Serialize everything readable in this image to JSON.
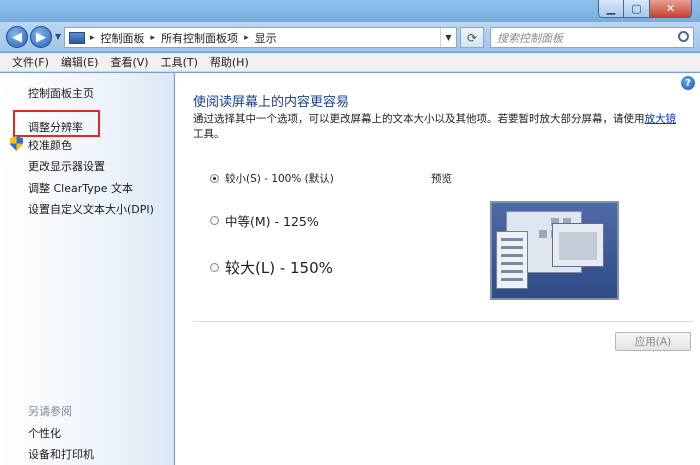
{
  "window": {
    "close_glyph": "✕",
    "maximize_glyph": "▢",
    "minimize_glyph": "▁"
  },
  "address": {
    "crumbs": [
      "控制面板",
      "所有控制面板项",
      "显示"
    ],
    "separator": "▸"
  },
  "search": {
    "placeholder": "搜索控制面板"
  },
  "menu": [
    "文件(F)",
    "编辑(E)",
    "查看(V)",
    "工具(T)",
    "帮助(H)"
  ],
  "sidebar": {
    "home": "控制面板主页",
    "links": [
      "调整分辨率",
      "校准颜色",
      "更改显示器设置",
      "调整 ClearType 文本",
      "设置自定义文本大小(DPI)"
    ],
    "see_also_title": "另请参阅",
    "see_also": [
      "个性化",
      "设备和打印机"
    ]
  },
  "main": {
    "title": "使阅读屏幕上的内容更容易",
    "description": "通过选择其中一个选项，可以更改屏幕上的文本大小以及其他项。若要暂时放大部分屏幕，请使用",
    "description_link": "放大镜",
    "description_tail": "工具。",
    "options": [
      {
        "label": "较小(S) - 100% (默认)",
        "selected": true
      },
      {
        "label": "中等(M) - 125%",
        "selected": false
      },
      {
        "label": "较大(L) - 150%",
        "selected": false
      }
    ],
    "preview_label": "预览",
    "apply_label": "应用(A)",
    "apply_enabled": false
  },
  "highlight_color": "#e2291f"
}
